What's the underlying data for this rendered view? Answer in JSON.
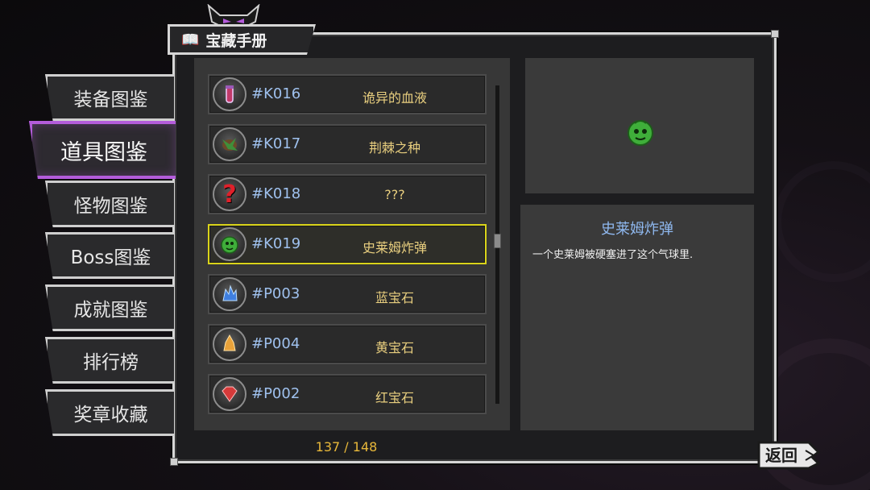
{
  "header": {
    "title": "宝藏手册",
    "icon": "open-book-icon"
  },
  "tabs": [
    {
      "label": "装备图鉴",
      "active": false
    },
    {
      "label": "道具图鉴",
      "active": true
    },
    {
      "label": "怪物图鉴",
      "active": false
    },
    {
      "label": "Boss图鉴",
      "active": false
    },
    {
      "label": "成就图鉴",
      "active": false
    },
    {
      "label": "排行榜",
      "active": false
    },
    {
      "label": "奖章收藏",
      "active": false
    }
  ],
  "items": [
    {
      "id": "#K016",
      "name": "诡异的血液",
      "icon": "blood-vial-icon",
      "selected": false
    },
    {
      "id": "#K017",
      "name": "荆棘之种",
      "icon": "thorn-seed-icon",
      "selected": false
    },
    {
      "id": "#K018",
      "name": "???",
      "icon": "question-mark-icon",
      "selected": false
    },
    {
      "id": "#K019",
      "name": "史莱姆炸弹",
      "icon": "slime-bomb-icon",
      "selected": true
    },
    {
      "id": "#P003",
      "name": "蓝宝石",
      "icon": "blue-gem-icon",
      "selected": false
    },
    {
      "id": "#P004",
      "name": "黄宝石",
      "icon": "yellow-gem-icon",
      "selected": false
    },
    {
      "id": "#P002",
      "name": "红宝石",
      "icon": "red-gem-icon",
      "selected": false
    }
  ],
  "counter": "137 / 148",
  "detail": {
    "title": "史莱姆炸弹",
    "description": "一个史莱姆被硬塞进了这个气球里.",
    "preview_icon": "slime-bomb-icon"
  },
  "back_button": {
    "label": "返回"
  },
  "colors": {
    "accent_active_tab": "#b45cdb",
    "selected_row_border": "#d9d31a",
    "item_id": "#9fc1ee",
    "item_name": "#e9cf7f",
    "counter": "#e8b83a",
    "detail_title": "#8fb8ef"
  }
}
